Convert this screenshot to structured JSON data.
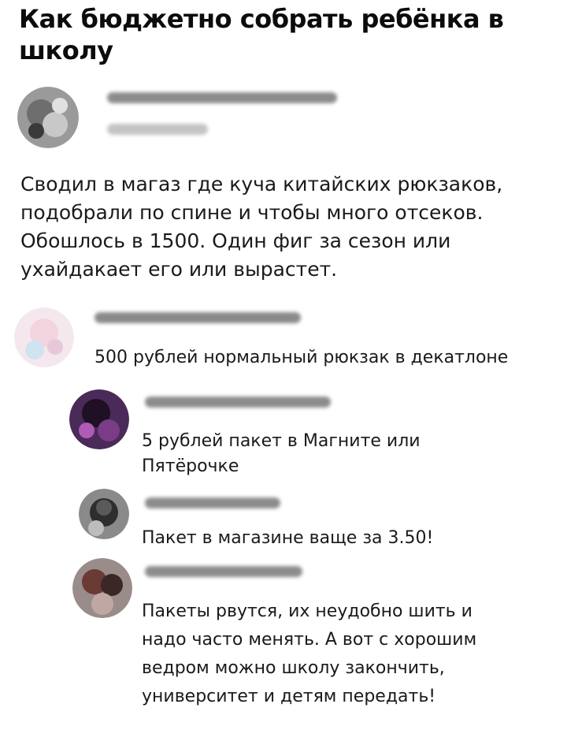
{
  "post": {
    "title": "Как бюджетно собрать ребёнка в школу",
    "text": "Сводил в магаз где куча китайских рюкзаков, подобрали по спине и чтобы много отсеков. Обошлось в 1500. Один фиг за сезон или ухайдакает его или вырастет."
  },
  "comments": [
    {
      "text": "500 рублей нормальный рюкзак в декатлоне"
    },
    {
      "text": "5 рублей пакет в Магните или Пятёрочке"
    },
    {
      "text": "Пакет в магазине ваще за 3.50!"
    },
    {
      "text": "Пакеты рвутся, их неудобно шить и надо часто менять. А вот с хорошим ведром можно школу закончить, университет и детям передать!"
    }
  ],
  "colors": {
    "background": "#ffffff",
    "text": "#1a1a1a"
  }
}
